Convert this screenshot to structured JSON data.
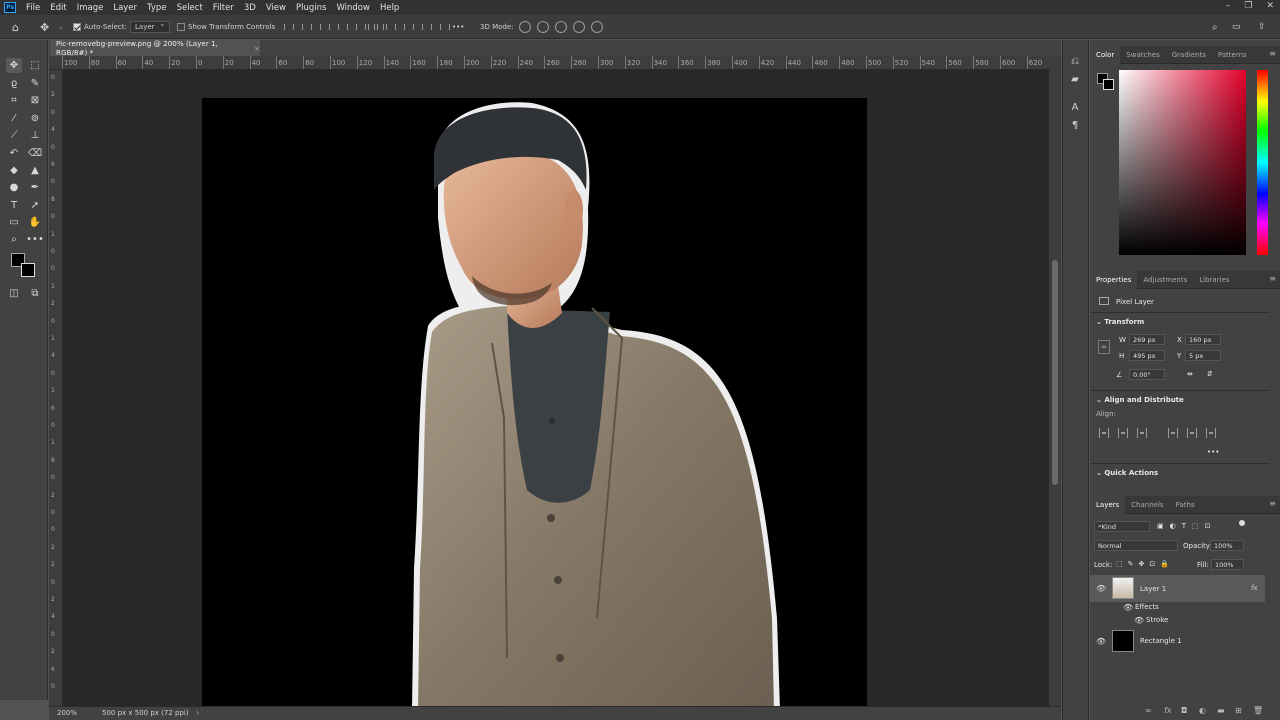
{
  "menubar": {
    "logo": "Ps",
    "items": [
      "File",
      "Edit",
      "Image",
      "Layer",
      "Type",
      "Select",
      "Filter",
      "3D",
      "View",
      "Plugins",
      "Window",
      "Help"
    ]
  },
  "options": {
    "auto_select_label": "Auto-Select:",
    "auto_select_value": "Layer",
    "show_transform_label": "Show Transform Controls",
    "mode_3d_label": "3D Mode:",
    "more_label": "•••"
  },
  "document": {
    "tab_title": "Pic-removebg-preview.png @ 200% (Layer 1, RGB/8#) *",
    "close": "×",
    "ruler_top": [
      "100",
      "80",
      "60",
      "40",
      "20",
      "0",
      "20",
      "40",
      "60",
      "80",
      "100",
      "120",
      "140",
      "160",
      "180",
      "200",
      "220",
      "240",
      "260",
      "280",
      "300",
      "320",
      "340",
      "360",
      "380",
      "400",
      "420",
      "440",
      "460",
      "480",
      "500",
      "520",
      "540",
      "560",
      "580",
      "600",
      "620"
    ],
    "ruler_left": [
      "0",
      "2",
      "0",
      "4",
      "0",
      "6",
      "0",
      "8",
      "0",
      "1",
      "0",
      "0",
      "1",
      "2",
      "0",
      "1",
      "4",
      "0",
      "1",
      "6",
      "0",
      "1",
      "8",
      "0",
      "2",
      "0",
      "0",
      "2",
      "2",
      "0",
      "2",
      "4",
      "0",
      "2",
      "6",
      "0"
    ]
  },
  "status": {
    "zoom": "200%",
    "doc_size": "500 px x 500 px (72 ppi)"
  },
  "color_panel": {
    "tabs": [
      "Color",
      "Swatches",
      "Gradients",
      "Patterns"
    ],
    "foreground": "#000000",
    "background": "#000000"
  },
  "properties_panel": {
    "tabs": [
      "Properties",
      "Adjustments",
      "Libraries"
    ],
    "pixel_layer": "Pixel Layer",
    "transform_label": "Transform",
    "w_label": "W",
    "w_value": "269 px",
    "h_label": "H",
    "h_value": "495 px",
    "x_label": "X",
    "x_value": "160 px",
    "y_label": "Y",
    "y_value": "5 px",
    "angle_value": "0.00°",
    "align_label": "Align and Distribute",
    "align_sub": "Align:",
    "more": "•••",
    "quick_actions": "Quick Actions"
  },
  "layers_panel": {
    "tabs": [
      "Layers",
      "Channels",
      "Paths"
    ],
    "kind": "Kind",
    "blend_mode": "Normal",
    "opacity_label": "Opacity:",
    "opacity_value": "100%",
    "lock_label": "Lock:",
    "fill_label": "Fill:",
    "fill_value": "100%",
    "layers": [
      {
        "name": "Layer 1",
        "fx": "fx"
      },
      {
        "name": "Rectangle 1"
      }
    ],
    "effects_label": "Effects",
    "stroke_label": "Stroke"
  },
  "icons": {
    "move": "move-icon",
    "marquee": "marquee-icon",
    "lasso": "lasso-icon",
    "quick_select": "quick-select-icon",
    "crop": "crop-icon",
    "frame": "frame-icon",
    "eyedropper": "eyedropper-icon",
    "healing": "healing-icon",
    "brush": "brush-icon",
    "stamp": "stamp-icon",
    "history_brush": "history-brush-icon",
    "eraser": "eraser-icon",
    "bucket": "bucket-icon",
    "blur": "blur-icon",
    "dodge": "dodge-icon",
    "pen": "pen-icon",
    "type": "type-icon",
    "path_select": "path-select-icon",
    "rectangle": "rectangle-icon",
    "hand": "hand-icon",
    "zoom": "zoom-icon"
  }
}
